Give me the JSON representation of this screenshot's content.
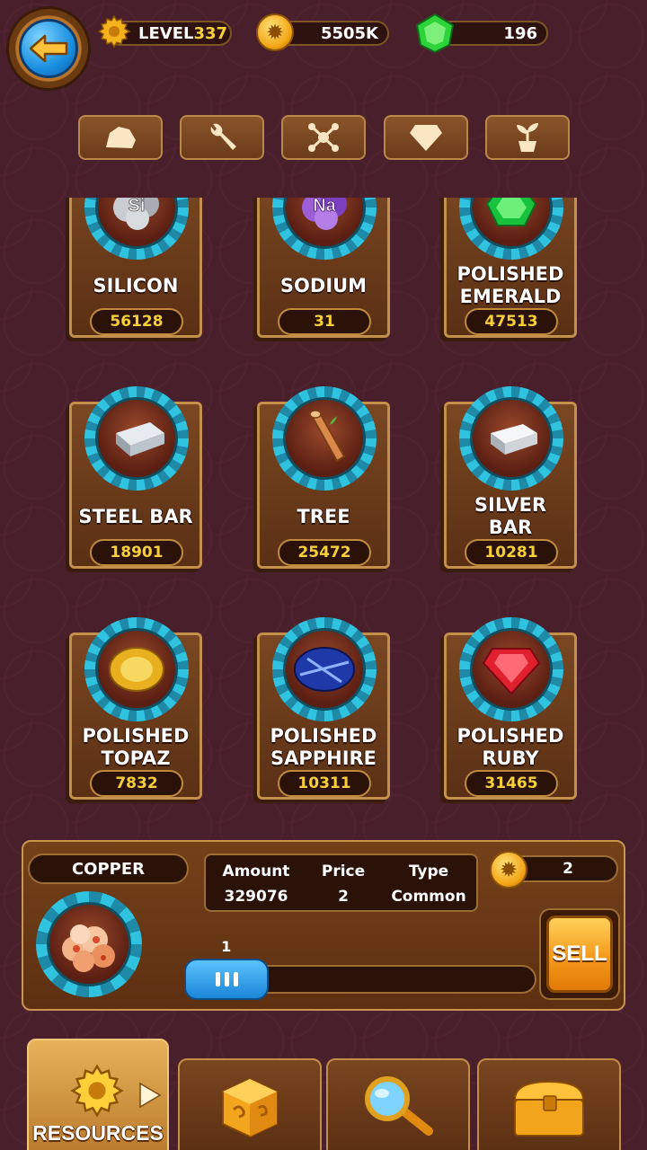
{
  "header": {
    "level_label": "LEVEL",
    "level_value": "337",
    "coins": "5505K",
    "gems": "196"
  },
  "category_tabs": [
    {
      "name": "rock-icon"
    },
    {
      "name": "wrench-icon"
    },
    {
      "name": "molecule-icon"
    },
    {
      "name": "diamond-icon"
    },
    {
      "name": "plant-icon"
    }
  ],
  "resources": [
    {
      "label": "SILICON",
      "count": "56128",
      "icon": "silicon-icon",
      "symbol": "Si"
    },
    {
      "label": "SODIUM",
      "count": "31",
      "icon": "sodium-icon",
      "symbol": "Na"
    },
    {
      "label": "POLISHED\nEMERALD",
      "count": "47513",
      "icon": "emerald-icon"
    },
    {
      "label": "STEEL BAR",
      "count": "18901",
      "icon": "steel-bar-icon"
    },
    {
      "label": "TREE",
      "count": "25472",
      "icon": "log-icon"
    },
    {
      "label": "SILVER\nBAR",
      "count": "10281",
      "icon": "silver-bar-icon"
    },
    {
      "label": "POLISHED\nTOPAZ",
      "count": "7832",
      "icon": "topaz-icon"
    },
    {
      "label": "POLISHED\nSAPPHIRE",
      "count": "10311",
      "icon": "sapphire-icon"
    },
    {
      "label": "POLISHED\nRUBY",
      "count": "31465",
      "icon": "ruby-icon"
    }
  ],
  "detail": {
    "name": "COPPER",
    "amount_label": "Amount",
    "amount_value": "329076",
    "price_label": "Price",
    "price_value": "2",
    "type_label": "Type",
    "type_value": "Common",
    "sell_total": "2",
    "slider_value": "1",
    "slider_fraction": 0.24,
    "sell_label": "SELL"
  },
  "bottom_nav": {
    "resources_label": "RESOURCES"
  },
  "colors": {
    "background": "#4a1f2c",
    "count_text": "#f7cf3b",
    "sell_button": "#f39a1a",
    "slider_handle": "#2a9be8"
  }
}
